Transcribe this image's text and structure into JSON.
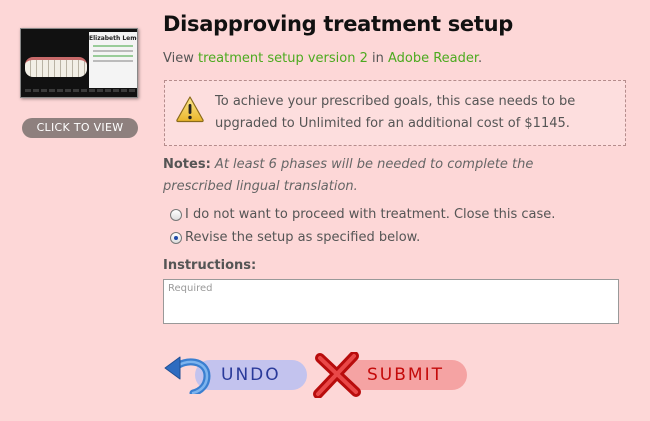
{
  "thumbnail": {
    "patient_name": "Elizabeth Lemon",
    "click_label": "CLICK TO VIEW"
  },
  "title": "Disapproving treatment setup",
  "view_line": {
    "prefix": "View ",
    "link1": "treatment setup version 2",
    "middle": " in ",
    "link2": "Adobe Reader",
    "suffix": "."
  },
  "warning": {
    "icon": "warning-icon",
    "text": "To achieve your prescribed goals, this case needs to be upgraded to Unlimited for an additional cost of $1145."
  },
  "notes": {
    "label": "Notes:",
    "text": "At least 6 phases will be needed to complete the prescribed lingual translation."
  },
  "options": [
    {
      "label": "I do not want to proceed with treatment. Close this case.",
      "selected": false
    },
    {
      "label": "Revise the setup as specified below.",
      "selected": true
    }
  ],
  "instructions": {
    "label": "Instructions:",
    "placeholder": "Required",
    "value": ""
  },
  "buttons": {
    "undo": {
      "label": "UNDO",
      "icon": "undo-arrow-icon"
    },
    "submit": {
      "label": "SUBMIT",
      "icon": "x-mark-icon"
    }
  },
  "colors": {
    "background": "#fdd7d7",
    "link": "#4caa1f",
    "undo_pill": "#c3c3ee",
    "undo_text": "#2a3a9a",
    "submit_pill": "#f5a3a3",
    "submit_text": "#c40a0a"
  }
}
